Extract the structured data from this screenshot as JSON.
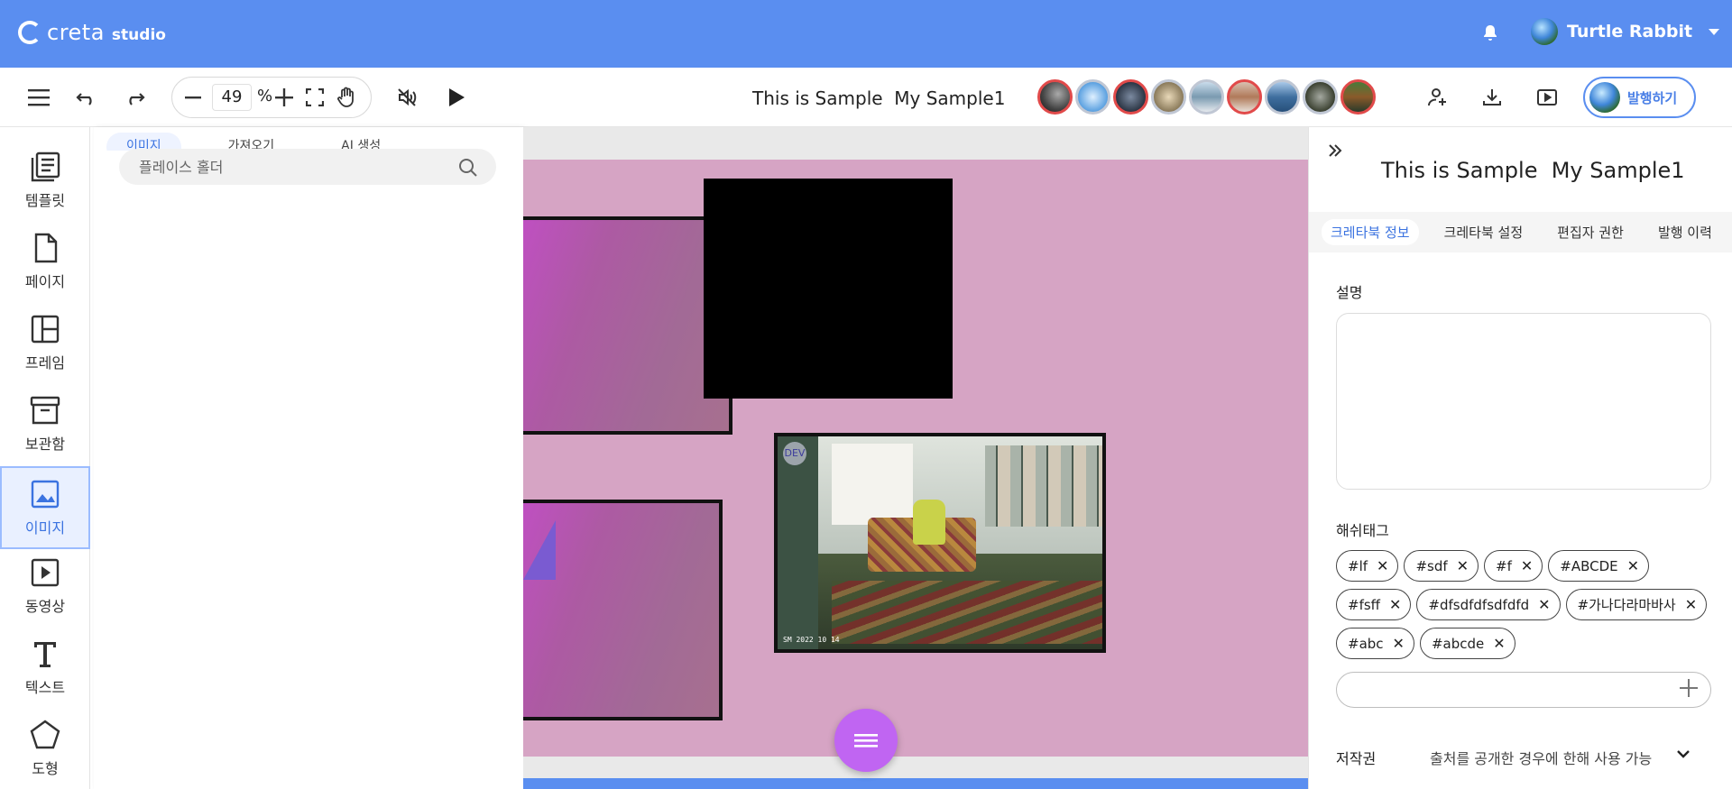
{
  "header": {
    "logo_text": "creta",
    "logo_sub": "studio",
    "user_name": "Turtle Rabbit",
    "icons": [
      "bell-icon",
      "chevron-down-icon"
    ],
    "bg_color": "#5a8ef0"
  },
  "toolbar": {
    "zoom_value": "49",
    "zoom_unit": "%",
    "doc_title": "This is Sample  My Sample1",
    "publish_label": "발행하기",
    "icons": [
      "menu-icon",
      "undo-icon",
      "redo-icon",
      "zoom-out-icon",
      "zoom-in-icon",
      "fullscreen-icon",
      "hand-icon",
      "mute-icon",
      "play-icon",
      "add-user-icon",
      "download-icon",
      "preview-icon"
    ],
    "collaborator_count": 9
  },
  "sidebar": {
    "items": [
      {
        "label": "템플릿",
        "icon": "template-icon"
      },
      {
        "label": "페이지",
        "icon": "page-icon"
      },
      {
        "label": "프레임",
        "icon": "frame-icon"
      },
      {
        "label": "보관함",
        "icon": "archive-icon"
      },
      {
        "label": "이미지",
        "icon": "image-icon",
        "active": true
      },
      {
        "label": "동영상",
        "icon": "video-icon"
      },
      {
        "label": "텍스트",
        "icon": "text-icon"
      },
      {
        "label": "도형",
        "icon": "shape-icon"
      }
    ]
  },
  "library": {
    "tabs": [
      "이미지",
      "가져오기",
      "AI 생성"
    ],
    "search_placeholder": "플레이스 홀더"
  },
  "canvas": {
    "photo_badge": "DEV",
    "photo_stamp": "SM  2022 10 14",
    "page_color": "#d6a4c4"
  },
  "right_panel": {
    "title": "This is Sample  My Sample1",
    "tabs": [
      "크레타북 정보",
      "크레타북 설정",
      "편집자 권한",
      "발행 이력"
    ],
    "description_label": "설명",
    "hashtag_label": "해쉬태그",
    "hashtags": [
      "#lf",
      "#sdf",
      "#f",
      "#ABCDE",
      "#fsff",
      "#dfsdfdfsdfdfd",
      "#가나다라마바사",
      "#abc",
      "#abcde"
    ],
    "license_label": "저작권",
    "license_value": "출처를 공개한 경우에 한해 사용 가능"
  }
}
